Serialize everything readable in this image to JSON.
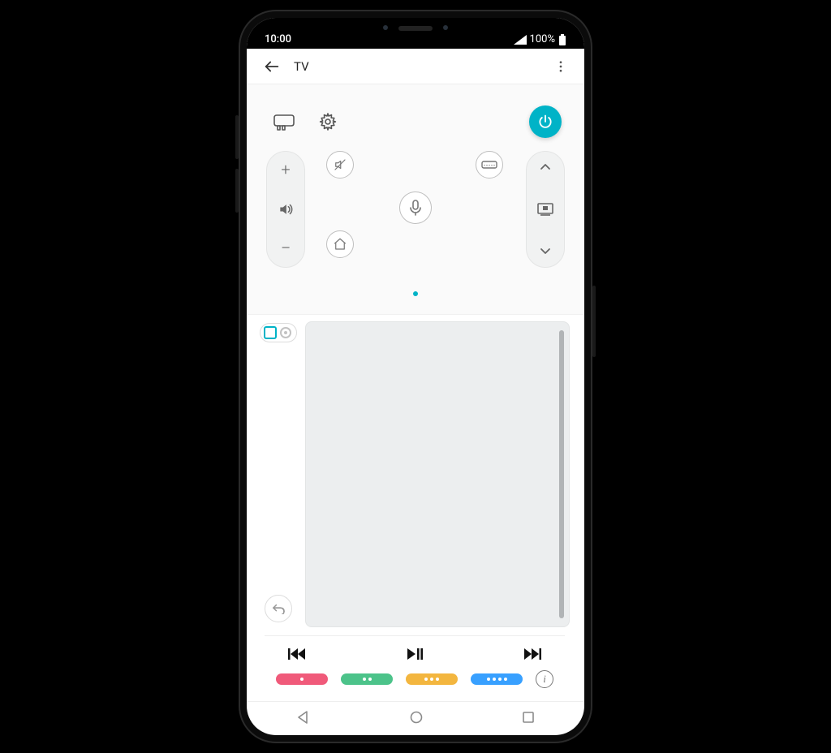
{
  "status": {
    "time": "10:00",
    "battery": "100%"
  },
  "header": {
    "title": "TV"
  },
  "icons": {
    "input": "input-icon",
    "settings": "gear-icon",
    "power": "power-icon",
    "mute": "mute-icon",
    "source": "source-icon",
    "mic": "mic-icon",
    "home": "home-icon",
    "guide": "guide-icon",
    "back_arrow": "back-arrow-icon",
    "menu": "more-menu-icon",
    "return": "return-icon",
    "info": "i"
  },
  "controls": {
    "vol_up": "+",
    "vol_down": "−",
    "ch_up": "˄",
    "ch_down": "˅"
  },
  "colors": {
    "accent": "#00b3c7",
    "red": "#f05a7a",
    "green": "#4cc38a",
    "yellow": "#f3b63f",
    "blue": "#38a0ff"
  }
}
